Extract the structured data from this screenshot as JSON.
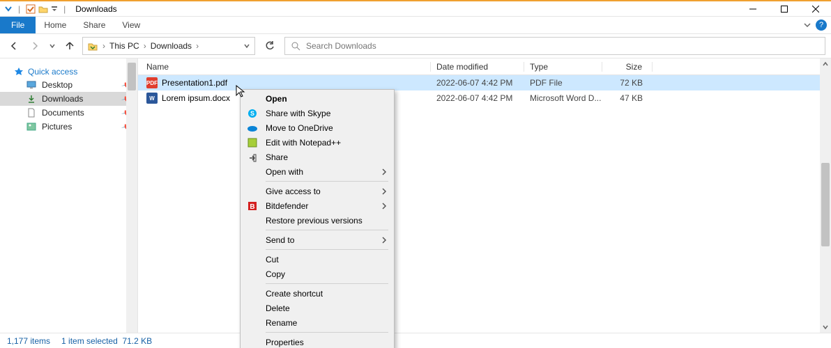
{
  "window": {
    "title": "Downloads"
  },
  "ribbon": {
    "file": "File",
    "home": "Home",
    "share": "Share",
    "view": "View"
  },
  "address": {
    "crumbs": [
      "This PC",
      "Downloads"
    ]
  },
  "search": {
    "placeholder": "Search Downloads"
  },
  "sidebar": {
    "quick_access": "Quick access",
    "items": [
      {
        "label": "Desktop"
      },
      {
        "label": "Downloads"
      },
      {
        "label": "Documents"
      },
      {
        "label": "Pictures"
      }
    ]
  },
  "columns": {
    "name": "Name",
    "date": "Date modified",
    "type": "Type",
    "size": "Size"
  },
  "files": [
    {
      "icon": "pdf",
      "name": "Presentation1.pdf",
      "date": "2022-06-07 4:42 PM",
      "type": "PDF File",
      "size": "72 KB",
      "selected": true
    },
    {
      "icon": "docx",
      "name": "Lorem ipsum.docx",
      "date": "2022-06-07 4:42 PM",
      "type": "Microsoft Word D...",
      "size": "47 KB",
      "selected": false
    }
  ],
  "context_menu": {
    "items": [
      {
        "label": "Open",
        "bold": true
      },
      {
        "label": "Share with Skype",
        "icon": "skype"
      },
      {
        "label": "Move to OneDrive",
        "icon": "onedrive"
      },
      {
        "label": "Edit with Notepad++",
        "icon": "npp"
      },
      {
        "label": "Share",
        "icon": "share"
      },
      {
        "label": "Open with",
        "submenu": true
      },
      {
        "sep": true
      },
      {
        "label": "Give access to",
        "submenu": true
      },
      {
        "label": "Bitdefender",
        "icon": "bitdefender",
        "submenu": true
      },
      {
        "label": "Restore previous versions"
      },
      {
        "sep": true
      },
      {
        "label": "Send to",
        "submenu": true
      },
      {
        "sep": true
      },
      {
        "label": "Cut"
      },
      {
        "label": "Copy"
      },
      {
        "sep": true
      },
      {
        "label": "Create shortcut"
      },
      {
        "label": "Delete"
      },
      {
        "label": "Rename"
      },
      {
        "sep": true
      },
      {
        "label": "Properties"
      }
    ]
  },
  "status": {
    "total": "1,177 items",
    "selected": "1 item selected",
    "size": "71.2 KB"
  }
}
